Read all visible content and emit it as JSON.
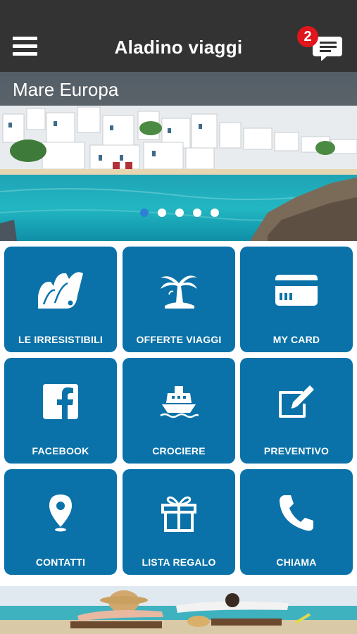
{
  "header": {
    "title": "Aladino viaggi",
    "notification_count": "2",
    "menu_icon": "hamburger-menu-icon",
    "chat_icon": "chat-bubble-icon"
  },
  "banner": {
    "label": "Mare Europa",
    "slide_count": 5,
    "active_slide": 1
  },
  "tiles": [
    {
      "label": "LE IRRESISTIBILI",
      "icon": "swatch-fan-icon"
    },
    {
      "label": "OFFERTE VIAGGI",
      "icon": "palm-island-icon"
    },
    {
      "label": "MY CARD",
      "icon": "card-icon"
    },
    {
      "label": "FACEBOOK",
      "icon": "facebook-icon"
    },
    {
      "label": "CROCIERE",
      "icon": "ship-icon"
    },
    {
      "label": "PREVENTIVO",
      "icon": "edit-icon"
    },
    {
      "label": "CONTATTI",
      "icon": "location-pin-icon"
    },
    {
      "label": "LISTA REGALO",
      "icon": "gift-icon"
    },
    {
      "label": "CHIAMA",
      "icon": "phone-icon"
    }
  ],
  "colors": {
    "header_bg": "#333333",
    "tile_bg": "#0a72a8",
    "badge_bg": "#e0161d",
    "active_dot": "#2f7fd6"
  }
}
